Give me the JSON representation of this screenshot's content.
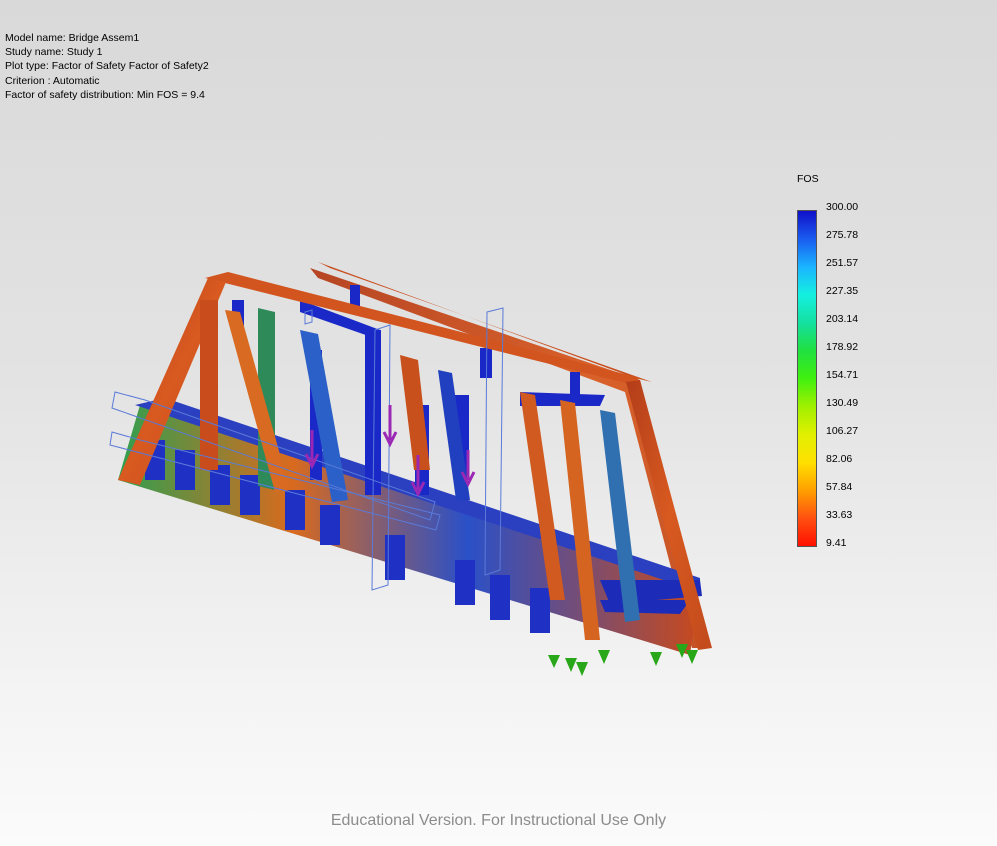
{
  "plot_info": {
    "model_name": "Model name: Bridge Assem1",
    "study_name": "Study name: Study 1",
    "plot_type": "Plot type: Factor of Safety Factor of Safety2",
    "criterion": "Criterion : Automatic",
    "distribution": "Factor of safety distribution: Min FOS = 9.4"
  },
  "legend": {
    "title": "FOS",
    "max": 300.0,
    "min": 9.41,
    "ticks": [
      "300.00",
      "275.78",
      "251.57",
      "227.35",
      "203.14",
      "178.92",
      "154.71",
      "130.49",
      "106.27",
      "82.06",
      "57.84",
      "33.63",
      "9.41"
    ],
    "colors": [
      "#1010c8",
      "#1a5cf0",
      "#1ab4ff",
      "#14f0e0",
      "#14e0a0",
      "#20e040",
      "#40f010",
      "#a0f000",
      "#e0f000",
      "#ffe000",
      "#ffa000",
      "#ff5010",
      "#ff1000"
    ]
  },
  "model_colors": {
    "frame": "#c0451e",
    "frame_light": "#e06a22",
    "stress_low": "#1a28c8",
    "stress_mid": "#20a860",
    "fixture": "#28a818",
    "load_arrow": "#9a28b4",
    "outline": "#5a7ad8"
  },
  "watermark": "Educational Version. For Instructional Use Only"
}
